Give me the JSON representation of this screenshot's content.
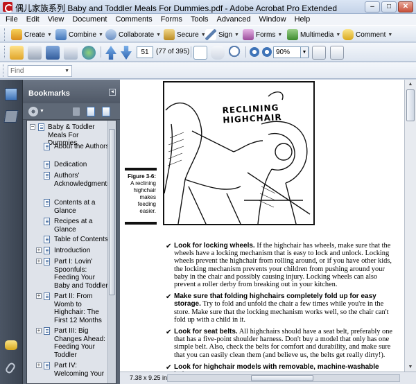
{
  "window": {
    "title": "偶儿家族系列 Baby and Toddler Meals For Dummies.pdf - Adobe Acrobat Pro Extended",
    "minimize": "–",
    "maximize": "□",
    "close": "✕"
  },
  "menu": [
    "File",
    "Edit",
    "View",
    "Document",
    "Comments",
    "Forms",
    "Tools",
    "Advanced",
    "Window",
    "Help"
  ],
  "task_toolbar": {
    "create": "Create",
    "combine": "Combine",
    "collaborate": "Collaborate",
    "secure": "Secure",
    "sign": "Sign",
    "forms": "Forms",
    "multimedia": "Multimedia",
    "comment": "Comment"
  },
  "nav_toolbar": {
    "page_number": "51",
    "page_count": "(77 of 395)",
    "zoom": "90%"
  },
  "find": {
    "placeholder": "Find"
  },
  "bookmarks": {
    "title": "Bookmarks",
    "collapse": "◂",
    "root": "Baby & Toddler Meals For Dummies",
    "items": [
      {
        "label": "About the Authors",
        "expandable": false
      },
      {
        "label": "Dedication",
        "expandable": false
      },
      {
        "label": "Authors' Acknowledgments",
        "expandable": false
      },
      {
        "label": "Contents at a Glance",
        "expandable": false
      },
      {
        "label": "Recipes at a Glance",
        "expandable": false
      },
      {
        "label": "Table of Contents",
        "expandable": false
      },
      {
        "label": "Introduction",
        "expandable": true
      },
      {
        "label": "Part I: Lovin' Spoonfuls: Feeding Your Baby and Toddler",
        "expandable": true
      },
      {
        "label": "Part II: From Womb to Highchair: The First 12 Months",
        "expandable": true
      },
      {
        "label": "Part III: Big Changes Ahead: Feeding Your Toddler",
        "expandable": true
      },
      {
        "label": "Part IV: Welcoming Your",
        "expandable": true
      }
    ]
  },
  "page": {
    "figure_art_title": "RECLINING HIGHCHAIR",
    "figure_label": "Figure 3-6:",
    "figure_caption": "A reclining highchair makes feeding easier.",
    "bullets": [
      {
        "bold": "Look for locking wheels.",
        "text": " If the highchair has wheels, make sure that the wheels have a locking mechanism that is easy to lock and unlock. Locking wheels prevent the highchair from rolling around, or if you have other kids, the locking mechanism prevents your children from pushing around your baby in the chair and possibly causing injury. Locking wheels can also prevent a roller derby from breaking out in your kitchen."
      },
      {
        "bold": "Make sure that folding highchairs completely fold up for easy storage.",
        "text": " Try to fold and unfold the chair a few times while you're in the store. Make sure that the locking mechanism works well, so the chair can't fold up with a child in it."
      },
      {
        "bold": "Look for seat belts.",
        "text": " All highchairs should have a seat belt, preferably one that has a five-point shoulder harness. Don't buy a model that only has one simple belt. Also, check the belts for comfort and durability, and make sure that you can easily clean them (and believe us, the belts get really dirty!)."
      },
      {
        "bold": "Look for highchair models with removable, machine-washable belts.",
        "text": ""
      }
    ]
  },
  "status": {
    "dimensions": "7.38 x 9.25 in"
  },
  "colors": {
    "rail": "#4b5564",
    "panel": "#5a6472",
    "accent_red": "#c0161c"
  }
}
